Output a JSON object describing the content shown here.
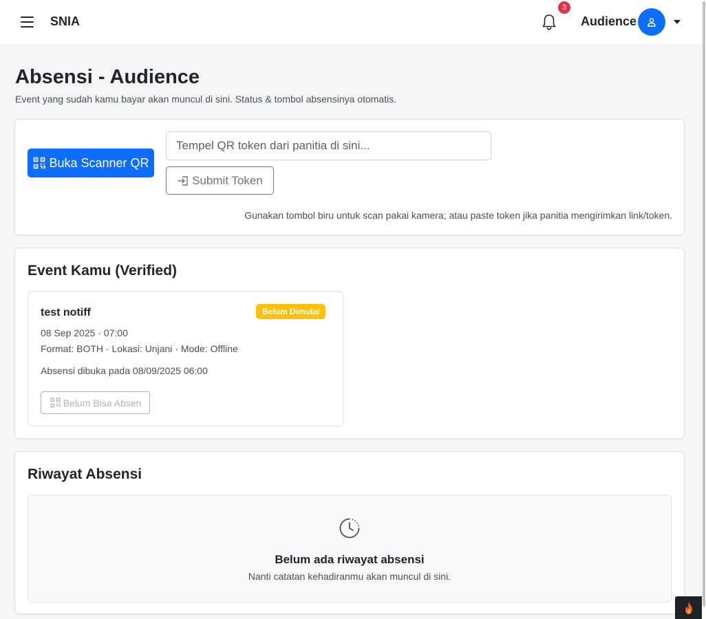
{
  "navbar": {
    "brand": "SNIA",
    "notification_count": "3",
    "user_name": "Audience"
  },
  "page": {
    "title": "Absensi - Audience",
    "subtitle": "Event yang sudah kamu bayar akan muncul di sini. Status & tombol absensinya otomatis."
  },
  "scanner": {
    "scan_button_label": "Buka Scanner QR",
    "token_placeholder": "Tempel QR token dari panitia di sini...",
    "submit_label": "Submit Token",
    "hint": "Gunakan tombol biru untuk scan pakai kamera; atau paste token jika panitia mengirimkan link/token."
  },
  "events": {
    "title": "Event Kamu (Verified)",
    "items": [
      {
        "name": "test notiff",
        "status": "Belum Dimulai",
        "datetime": "08 Sep 2025 · 07:00",
        "details": "Format: BOTH · Lokasi: Unjani · Mode: Offline",
        "opens": "Absensi dibuka pada 08/09/2025 06:00",
        "button_label": "Belum Bisa Absen"
      }
    ]
  },
  "history": {
    "title": "Riwayat Absensi",
    "empty_title": "Belum ada riwayat absensi",
    "empty_sub": "Nanti catatan kehadiranmu akan muncul di sini."
  },
  "icons": {
    "menu": "hamburger-icon",
    "notification": "bell-icon",
    "avatar": "user-icon",
    "dropdown": "caret-down-icon",
    "scan": "qr-scan-icon",
    "submit": "login-icon",
    "empty": "clock-history-icon",
    "devtools": "flame-icon"
  },
  "colors": {
    "primary": "#0d6efd",
    "warning": "#ffc107",
    "danger": "#dc3545",
    "muted": "#6c757d"
  }
}
